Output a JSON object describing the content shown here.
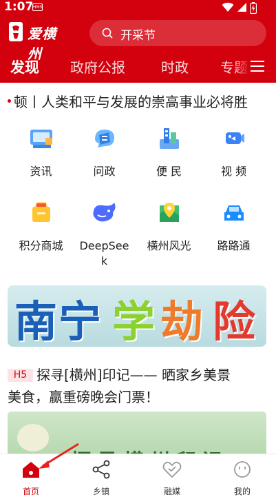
{
  "status_bar": {
    "time": "1:07",
    "hms_label": "HMS"
  },
  "header": {
    "brand": "爱横州",
    "search_placeholder": "开采节"
  },
  "tabs": [
    {
      "label": "发现"
    },
    {
      "label": "政府公报"
    },
    {
      "label": "时政"
    },
    {
      "label": "专题"
    }
  ],
  "ticker": {
    "text": "顿丨人类和平与发展的崇高事业必将胜"
  },
  "grid": [
    {
      "label": "资讯",
      "icon": "news-icon"
    },
    {
      "label": "问政",
      "icon": "inquiry-icon"
    },
    {
      "label": "便 民",
      "icon": "service-icon"
    },
    {
      "label": "视 频",
      "icon": "video-icon"
    },
    {
      "label": "积分商城",
      "icon": "points-mall-icon"
    },
    {
      "label_line1": "DeepSee",
      "label_line2": "k",
      "icon": "deepseek-icon"
    },
    {
      "label": "横州风光",
      "icon": "map-pin-icon"
    },
    {
      "label": "路路通",
      "icon": "car-icon"
    }
  ],
  "banner": {
    "c1": "南宁",
    "c2": "学",
    "c3": "劫",
    "c4": "险"
  },
  "article": {
    "badge": "H5",
    "title_line1": "探寻[横州]印记—— 晒家乡美景",
    "title_line2": "美食，赢重磅晚会门票！",
    "image_heading": "探寻横州印记"
  },
  "bottom_nav": [
    {
      "label": "首页",
      "icon": "home-icon"
    },
    {
      "label": "乡镇",
      "icon": "share-icon"
    },
    {
      "label": "融媒",
      "icon": "media-heart-icon"
    },
    {
      "label": "我的",
      "icon": "profile-icon"
    }
  ],
  "colors": {
    "brand_red": "#d3000d"
  }
}
